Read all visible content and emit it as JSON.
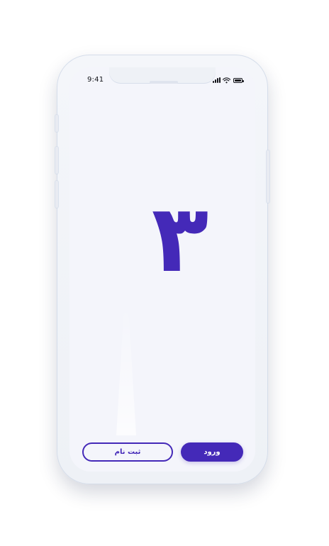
{
  "status_bar": {
    "time": "9:41"
  },
  "splash": {
    "digit": "۳"
  },
  "actions": {
    "register_label": "ثبت نام",
    "login_label": "ورود"
  },
  "theme": {
    "primary": "#4429b8",
    "screen_bg": "#f4f5fb"
  }
}
